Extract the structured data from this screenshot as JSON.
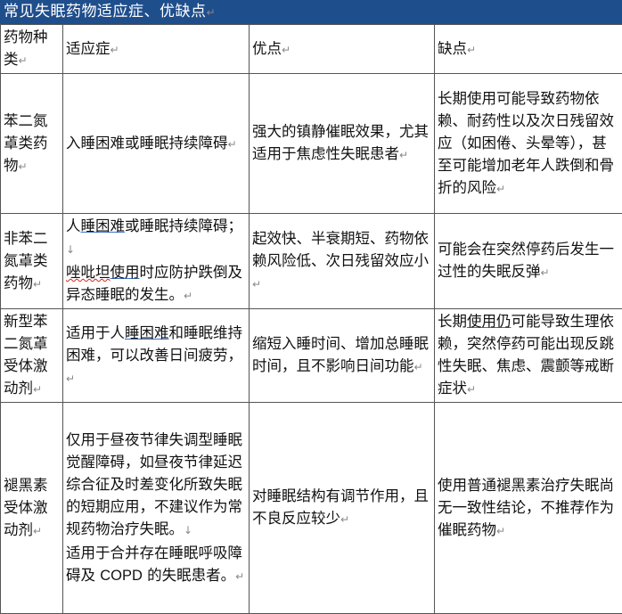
{
  "title": "常见失眠药物适应症、优缺点",
  "para_mark": "↵",
  "line_break_mark": "↓",
  "headers": [
    "药物种类",
    "适应症",
    "优点",
    "缺点"
  ],
  "rows": [
    {
      "drug": "苯二氮䓬类药物",
      "indication": "入睡困难或睡眠持续障碍",
      "advantage": "强大的镇静催眠效果，尤其适用于焦虑性失眠患者",
      "disadvantage": "长期使用可能导致药物依赖、耐药性以及次日残留效应（如困倦、头晕等），甚至可能增加老年人跌倒和骨折的风险"
    },
    {
      "drug": "非苯二氮䓬类药物",
      "indication_a": "人",
      "indication_b": "睡困难",
      "indication_c": "或睡眠持续障碍；",
      "indication_d": "唑吡坦",
      "indication_e": "使用",
      "indication_f": "时应防护跌倒及异态睡眠的发生。",
      "advantage": "起效快、半衰期短、药物依赖风险低、次日残留效应小",
      "disadvantage": "可能会在突然停药后发生一过性的失眠反弹"
    },
    {
      "drug": "新型苯二氮䓬受体激动剂",
      "indication_a": "适用于人",
      "indication_b": "睡困难",
      "indication_c": "和睡眠维持困难，可以改善日间疲劳，",
      "advantage": "缩短入睡时间、增加总睡眠时间，且不影响日间功能",
      "disadvantage_a": "长期",
      "disadvantage_b": "使用仍",
      "disadvantage_c": "可能导致生理依赖，突然停药可能出现反跳性失眠、焦虑、震颤等戒断症状"
    },
    {
      "drug": "褪黑素受体激动剂",
      "indication_a": "仅用于昼夜节律失调型睡眠觉醒障碍，如昼夜节律延迟综合征及时差变化所致失眠的短期应用，不建议作为常规药物治疗失眠。",
      "indication_b": "适用于合并存在睡眠呼吸障碍及 ",
      "indication_c": "COPD",
      "indication_d": " 的失眠患者。",
      "advantage": "对睡眠结构有调节作用，且不良反应较少",
      "disadvantage": "使用普通褪黑素治疗失眠尚无一致性结论，不推荐作为催眠药物"
    }
  ]
}
